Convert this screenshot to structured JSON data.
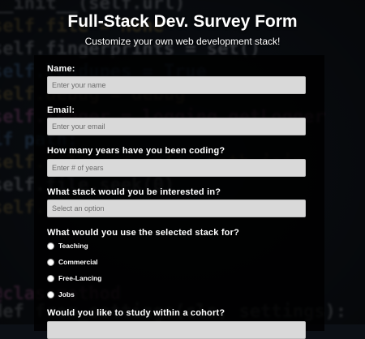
{
  "header": {
    "title": "Full-Stack Dev. Survey Form",
    "subtitle": "Customize your own web development stack!"
  },
  "form": {
    "name": {
      "label": "Name:",
      "placeholder": "Enter your name"
    },
    "email": {
      "label": "Email:",
      "placeholder": "Enter your email"
    },
    "years": {
      "label": "How many years have you been coding?",
      "placeholder": "Enter # of years"
    },
    "stack": {
      "label": "What stack would you be interested in?",
      "selected": "Select an option"
    },
    "usage": {
      "label": "What would you use the selected stack for?",
      "options": [
        "Teaching",
        "Commercial",
        "Free-Lancing",
        "Jobs"
      ]
    },
    "cohort": {
      "label": "Would you like to study within a cohort?"
    }
  }
}
